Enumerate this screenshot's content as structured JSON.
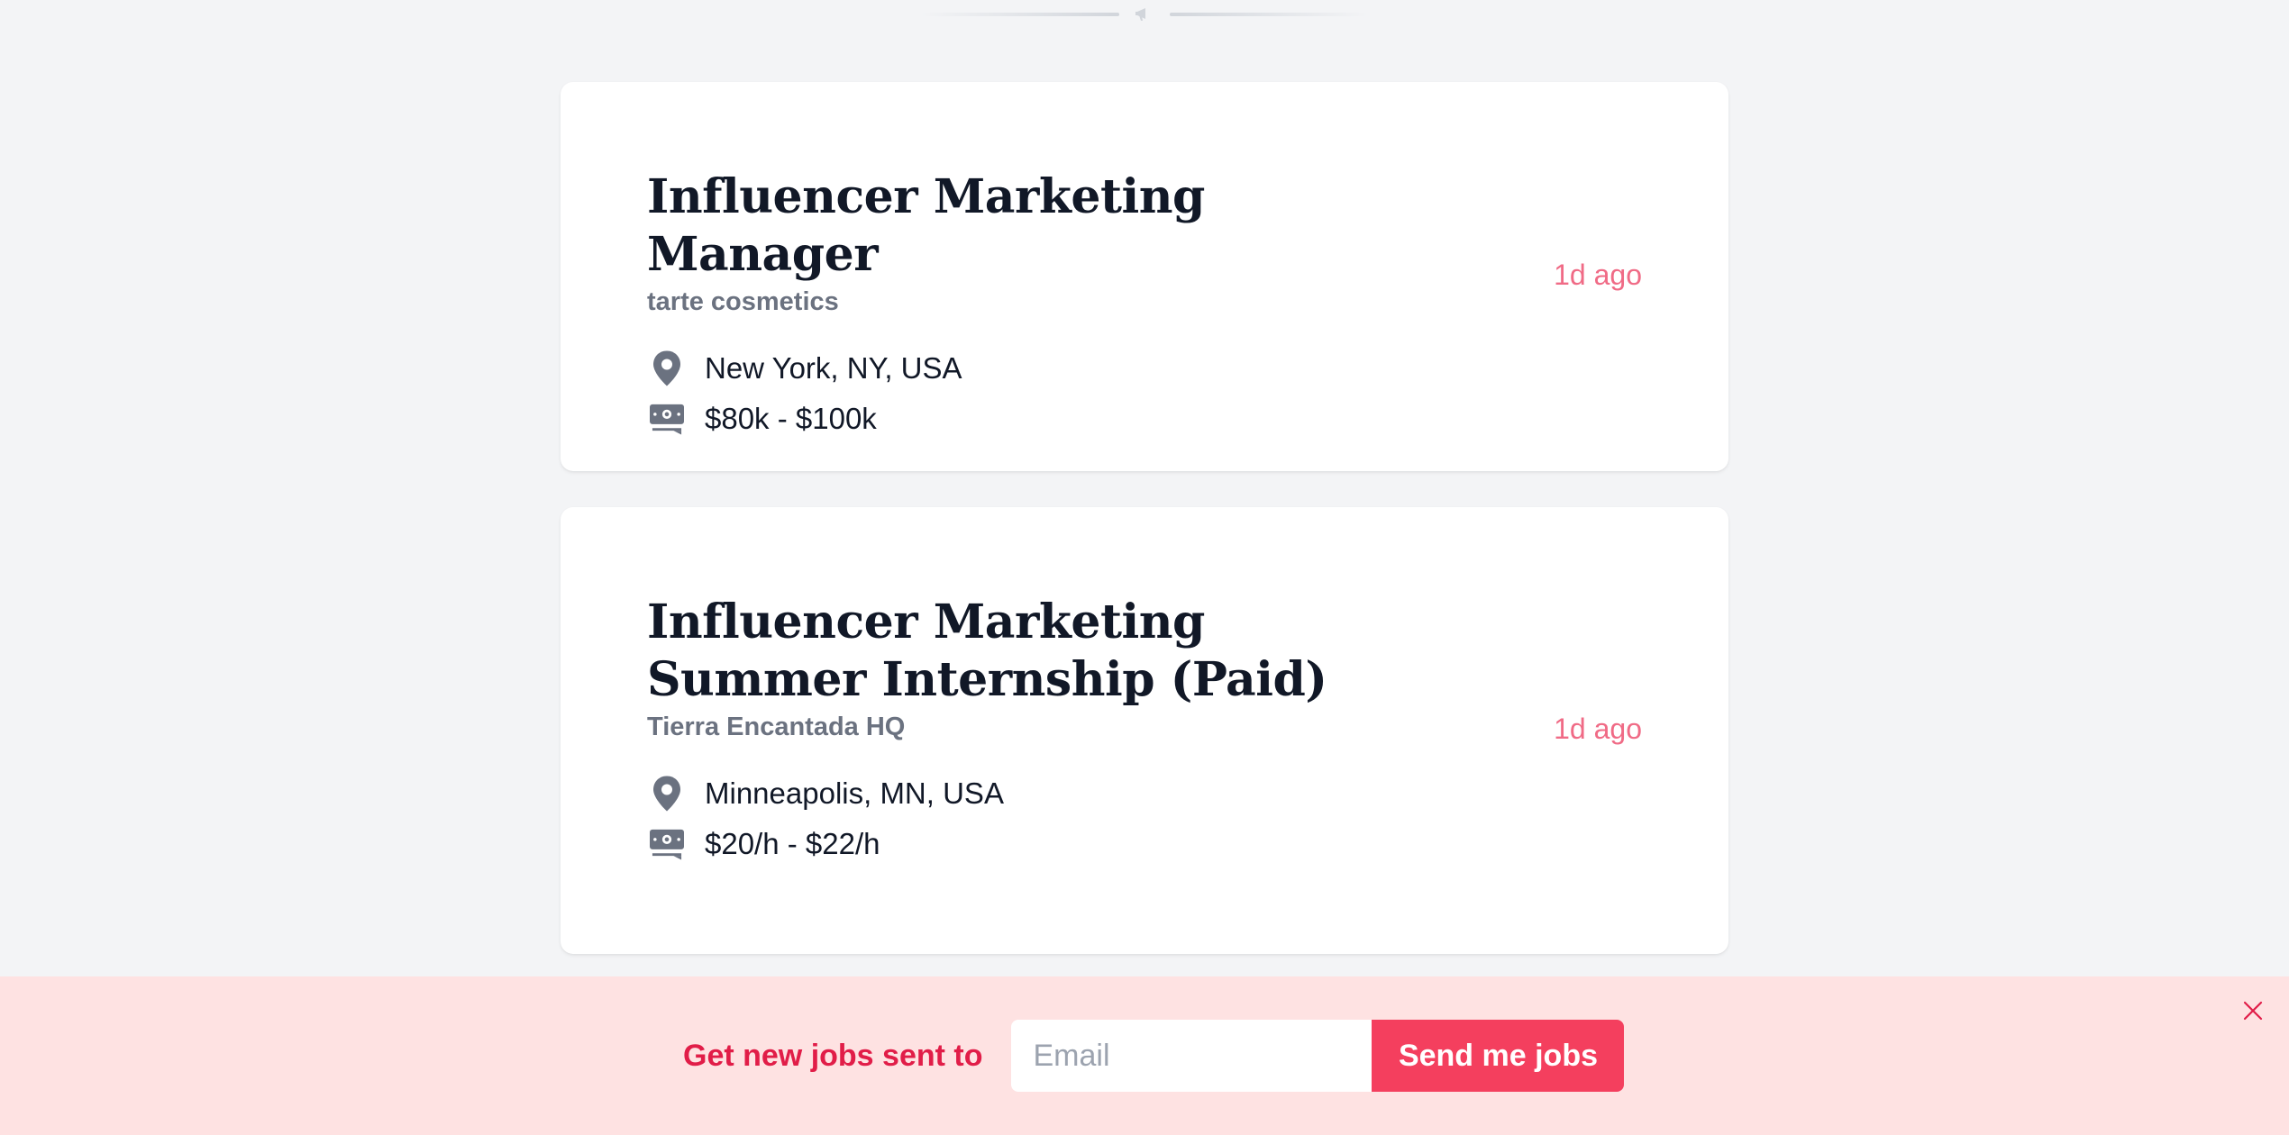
{
  "jobs": [
    {
      "title": "Influencer Marketing Manager",
      "company": "tarte cosmetics",
      "location": "New York, NY, USA",
      "salary": "$80k - $100k",
      "posted": "1d ago"
    },
    {
      "title": "Influencer Marketing Summer Internship (Paid)",
      "company": "Tierra Encantada HQ",
      "location": "Minneapolis, MN, USA",
      "salary": "$20/h - $22/h",
      "posted": "1d ago"
    }
  ],
  "banner": {
    "label": "Get new jobs sent to",
    "email_placeholder": "Email",
    "email_value": "",
    "button_label": "Send me jobs"
  },
  "colors": {
    "accent": "#f43f5e",
    "accent_text": "#e11d48",
    "time_ago": "#f06b86",
    "banner_bg": "#fee2e2",
    "icon_gray": "#6b7280"
  },
  "icons": {
    "divider": "megaphone-icon",
    "location": "map-pin-icon",
    "salary": "cash-icon",
    "close": "close-icon"
  }
}
